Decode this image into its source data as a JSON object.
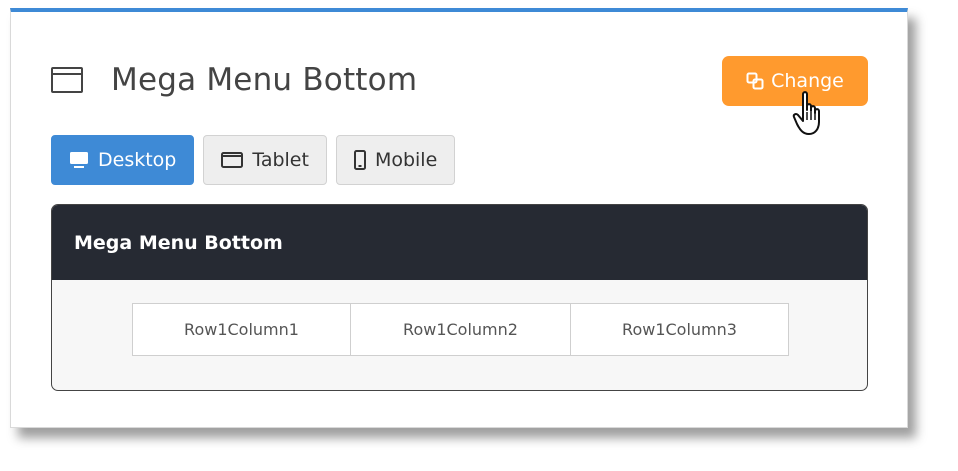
{
  "panel": {
    "title": "Mega Menu Bottom",
    "change_label": "Change"
  },
  "tabs": [
    {
      "label": "Desktop",
      "icon": "desktop-icon",
      "active": true
    },
    {
      "label": "Tablet",
      "icon": "tablet-icon",
      "active": false
    },
    {
      "label": "Mobile",
      "icon": "mobile-icon",
      "active": false
    }
  ],
  "preview": {
    "header": "Mega Menu Bottom",
    "columns": [
      "Row1Column1",
      "Row1Column2",
      "Row1Column3"
    ]
  },
  "colors": {
    "accent_blue": "#3e8ad6",
    "change_orange": "#ff9a2e",
    "preview_header_bg": "#262a33"
  }
}
